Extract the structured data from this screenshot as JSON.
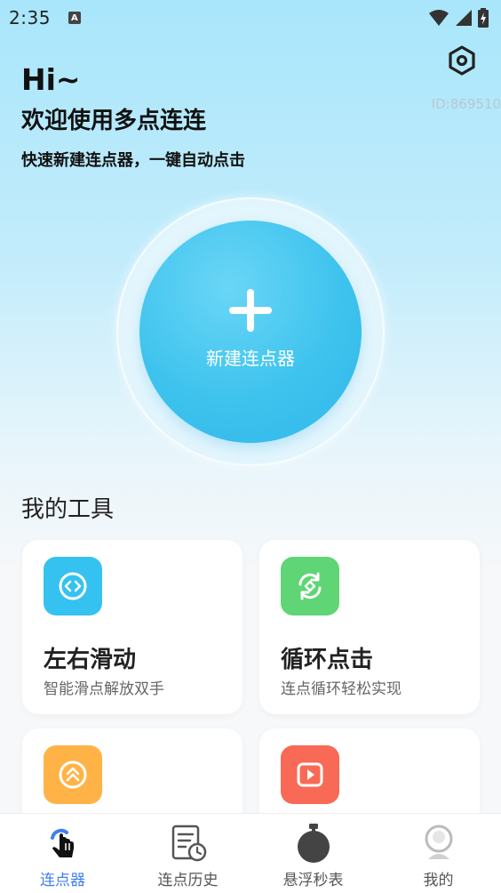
{
  "status_bar": {
    "time": "2:35",
    "notification_badge": "A"
  },
  "header": {
    "greeting": "Hi~",
    "welcome": "欢迎使用多点连连",
    "subtitle": "快速新建连点器，一键自动点击",
    "user_id": "ID:869510"
  },
  "main_button": {
    "label": "新建连点器"
  },
  "tools": {
    "title": "我的工具",
    "items": [
      {
        "title": "左右滑动",
        "desc": "智能滑点解放双手",
        "color": "#35c2f0",
        "icon": "swipe-icon"
      },
      {
        "title": "循环点击",
        "desc": "连点循环轻松实现",
        "color": "#5fd576",
        "icon": "loop-icon"
      },
      {
        "title": "",
        "desc": "",
        "color": "#ffb347",
        "icon": "double-up-icon"
      },
      {
        "title": "",
        "desc": "",
        "color": "#f86a55",
        "icon": "play-icon"
      }
    ]
  },
  "tab_bar": {
    "items": [
      {
        "label": "连点器",
        "icon": "tap-hand-icon",
        "active": true
      },
      {
        "label": "连点历史",
        "icon": "history-icon",
        "active": false
      },
      {
        "label": "悬浮秒表",
        "icon": "stopwatch-icon",
        "active": false
      },
      {
        "label": "我的",
        "icon": "profile-icon",
        "active": false
      }
    ]
  },
  "colors": {
    "accent": "#3f7ff1",
    "primary_circle": "#3ec3ee"
  }
}
